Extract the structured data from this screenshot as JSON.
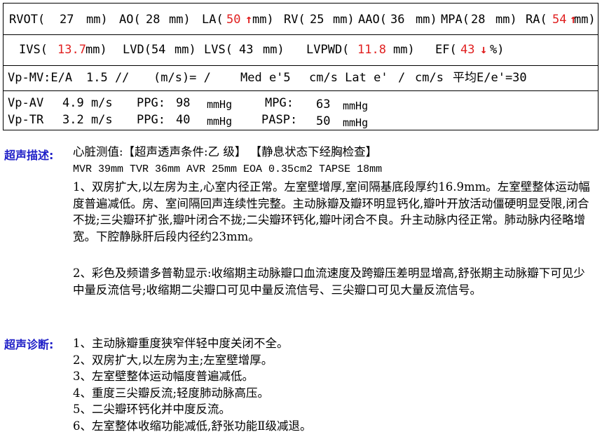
{
  "row1": {
    "rvot_label": "RVOT(",
    "rvot_val": "27",
    "rvot_unit": "mm)",
    "ao_label": "AO(",
    "ao_val": "28",
    "ao_unit": "mm)",
    "la_label": "LA(",
    "la_val": "50",
    "la_arrow": "↑",
    "la_unit": "mm)",
    "rv_label": "RV(",
    "rv_val": "25",
    "rv_unit": "mm)",
    "aao_label": "AAO(",
    "aao_val": "36",
    "aao_unit": "mm)",
    "mpa_label": "MPA(",
    "mpa_val": "28",
    "mpa_unit": "mm)",
    "ra_label": "RA(",
    "ra_val": "54",
    "ra_arrow": "↑",
    "ra_unit": "mm)"
  },
  "row2": {
    "ivs_label": "IVS(",
    "ivs_val": "13.7",
    "ivs_unit": "mm)",
    "lvd_label": "LVD(54",
    "lvd_unit": "mm)",
    "lvs_label": "LVS(",
    "lvs_val": "43",
    "lvs_unit": "mm)",
    "lvpwd_label": "LVPWD(",
    "lvpwd_val": "11.8",
    "lvpwd_unit": "mm)",
    "ef_label": "EF(",
    "ef_val": "43",
    "ef_arrow": "↓",
    "ef_unit": "%)"
  },
  "row3": {
    "label": "Vp-MV:E/A",
    "val": "1.5 //",
    "unit": "(m/s)= /",
    "med": "Med e'5",
    "med_unit": "cm/s Lat e'",
    "lat_val": "/",
    "lat_unit": "cm/s",
    "avg": "平均E/e'=30"
  },
  "row4": {
    "av_label": "Vp-AV",
    "av_val": "4.9 m/s",
    "av_ppg_label": "PPG:",
    "av_ppg_val": "98",
    "av_ppg_unit": "mmHg",
    "mpg_label": "MPG:",
    "mpg_val": "63",
    "mpg_unit": "mmHg",
    "tr_label": "Vp-TR",
    "tr_val": "3.2 m/s",
    "tr_ppg_label": "PPG:",
    "tr_ppg_val": "40",
    "tr_ppg_unit": "mmHg",
    "pasp_label": "PASP:",
    "pasp_val": "50",
    "pasp_unit": "mmHg"
  },
  "description": {
    "label": "超声描述:",
    "line1": "心脏测值:【超声透声条件:乙 级】 【静息状态下经胸检查】",
    "measures": "MVR 39mm  TVR 36mm  AVR 25mm  EOA 0.35cm2  TAPSE 18mm",
    "para1": "1、双房扩大,以左房为主,心室内径正常。左室壁增厚,室间隔基底段厚约16.9mm。左室壁整体运动幅度普遍减低。房、室间隔回声连续性完整。主动脉瓣及瓣环明显钙化,瓣叶开放活动僵硬明显受限,闭合不拢;三尖瓣环扩张,瓣叶闭合不拢;二尖瓣环钙化,瓣叶闭合不良。升主动脉内径正常。肺动脉内径略增宽。下腔静脉肝后段内径约23mm。",
    "para2": "2、彩色及频谱多普勒显示:收缩期主动脉瓣口血流速度及跨瓣压差明显增高,舒张期主动脉瓣下可见少中量反流信号;收缩期二尖瓣口可见中量反流信号、三尖瓣口可见大量反流信号。"
  },
  "diagnosis": {
    "label": "超声诊断:",
    "items": [
      "1、主动脉瓣重度狭窄伴轻中度关闭不全。",
      "2、双房扩大,以左房为主;左室壁增厚。",
      "3、左室壁整体运动幅度普遍减低。",
      "4、重度三尖瓣反流;轻度肺动脉高压。",
      "5、二尖瓣环钙化并中度反流。",
      "6、左室整体收缩功能减低,舒张功能Ⅱ级减退。"
    ]
  }
}
